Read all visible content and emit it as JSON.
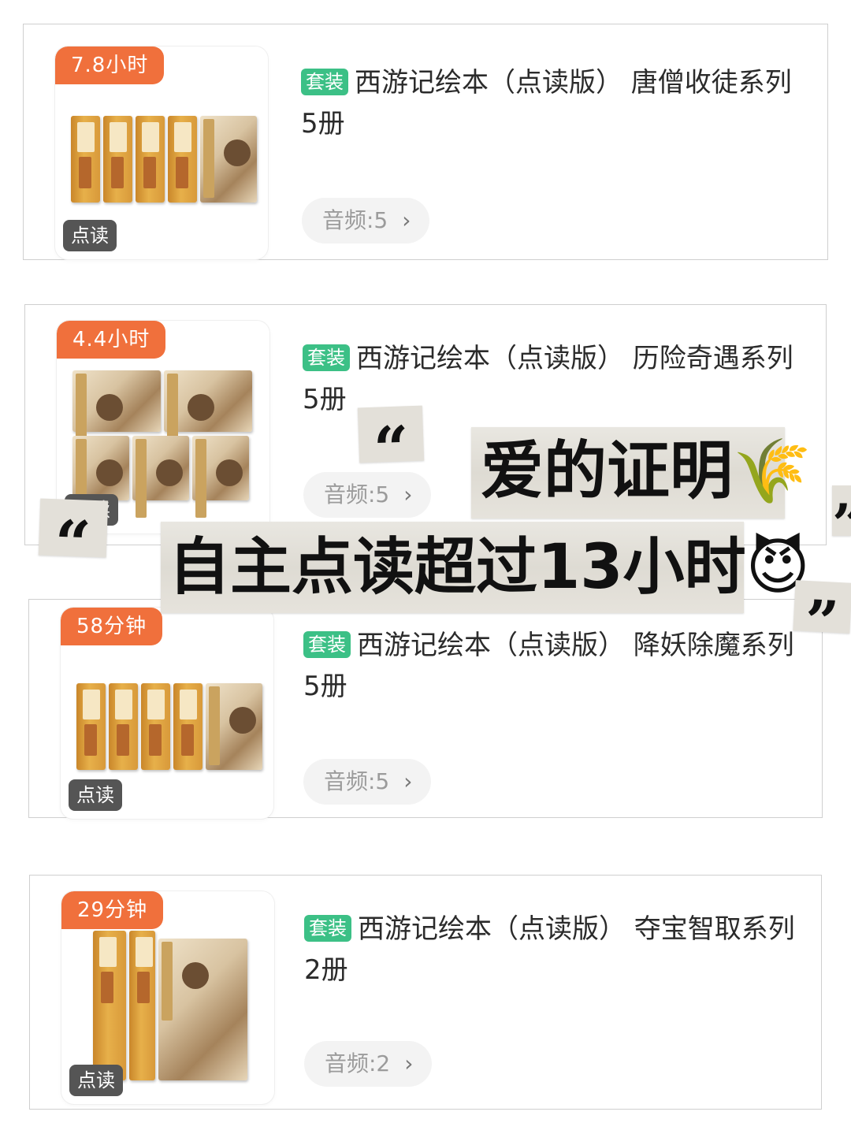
{
  "cards": [
    {
      "duration": "7.8小时",
      "badge": "点读",
      "tag": "套装",
      "title": "西游记绘本（点读版） 唐僧收徒系列 5册",
      "audio": "音频:5"
    },
    {
      "duration": "4.4小时",
      "badge": "点读",
      "tag": "套装",
      "title": "西游记绘本（点读版） 历险奇遇系列 5册",
      "audio": "音频:5"
    },
    {
      "duration": "58分钟",
      "badge": "点读",
      "tag": "套装",
      "title": "西游记绘本（点读版） 降妖除魔系列 5册",
      "audio": "音频:5"
    },
    {
      "duration": "29分钟",
      "badge": "点读",
      "tag": "套装",
      "title": "西游记绘本（点读版） 夺宝智取系列 2册",
      "audio": "音频:2"
    }
  ],
  "overlay": {
    "line1": "爱的证明🌾",
    "line2": "自主点读超过13小时😈",
    "open_quote": "“",
    "close_quote": "”"
  },
  "colors": {
    "duration_badge": "#f0703c",
    "set_tag": "#3cc086",
    "dian_badge": "#555555",
    "audio_button_bg": "#f3f3f3"
  },
  "icons": {
    "audio_chevron": "chevron-right-icon"
  }
}
